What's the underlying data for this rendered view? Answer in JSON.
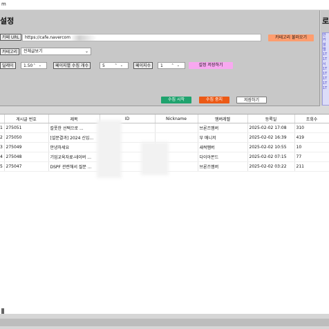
{
  "window": {
    "title": "m"
  },
  "settings": {
    "title": "설정",
    "cafe_url_label": "카페 URL",
    "cafe_url_value": "https://cafe.navercom",
    "load_category_button": "카테고리 불러오기",
    "category_label": "카테고리",
    "category_value": "전체글보기",
    "delay_label": "딜레이",
    "delay_value": "1.50",
    "per_page_label": "페이지별 수집 개수",
    "per_page_value": "5",
    "pages_label": "페이지수",
    "pages_value": "1",
    "save_settings_button": "설정 저장하기",
    "start_button": "수집 시작",
    "stop_button": "수집 중지",
    "save_button": "저장하기"
  },
  "right_panel": {
    "title": "로",
    "items": [
      "안",
      "카",
      "설",
      "엘",
      "1T",
      "1T",
      "시",
      "1T",
      "1T",
      "1T",
      "1T",
      "1T"
    ]
  },
  "table": {
    "columns": [
      "",
      "게시글 번호",
      "제목",
      "ID",
      "Nickname",
      "멤버레벨",
      "등록일",
      "조회수"
    ],
    "rows": [
      [
        "1",
        "275051",
        "칼풋한 선택으로 ...",
        "",
        "",
        "브론즈멤버",
        "2025-02-02 17:08",
        "310"
      ],
      [
        "2",
        "275050",
        "[설문결과] 2024 신입...",
        "",
        "",
        "부 매니저",
        "2025-02-02 16:39",
        "419"
      ],
      [
        "3",
        "275049",
        "안녕하세요",
        "",
        "",
        "새싹멤버",
        "2025-02-02 10:55",
        "10"
      ],
      [
        "4",
        "275048",
        "기업교육자료-네이버 ...",
        "",
        "",
        "다이아몬드",
        "2025-02-02 07:15",
        "77"
      ],
      [
        "5",
        "275047",
        "DSPF 관련해서 질문 ...",
        "",
        "",
        "브론즈멤버",
        "2025-02-02 03:22",
        "211"
      ]
    ]
  }
}
